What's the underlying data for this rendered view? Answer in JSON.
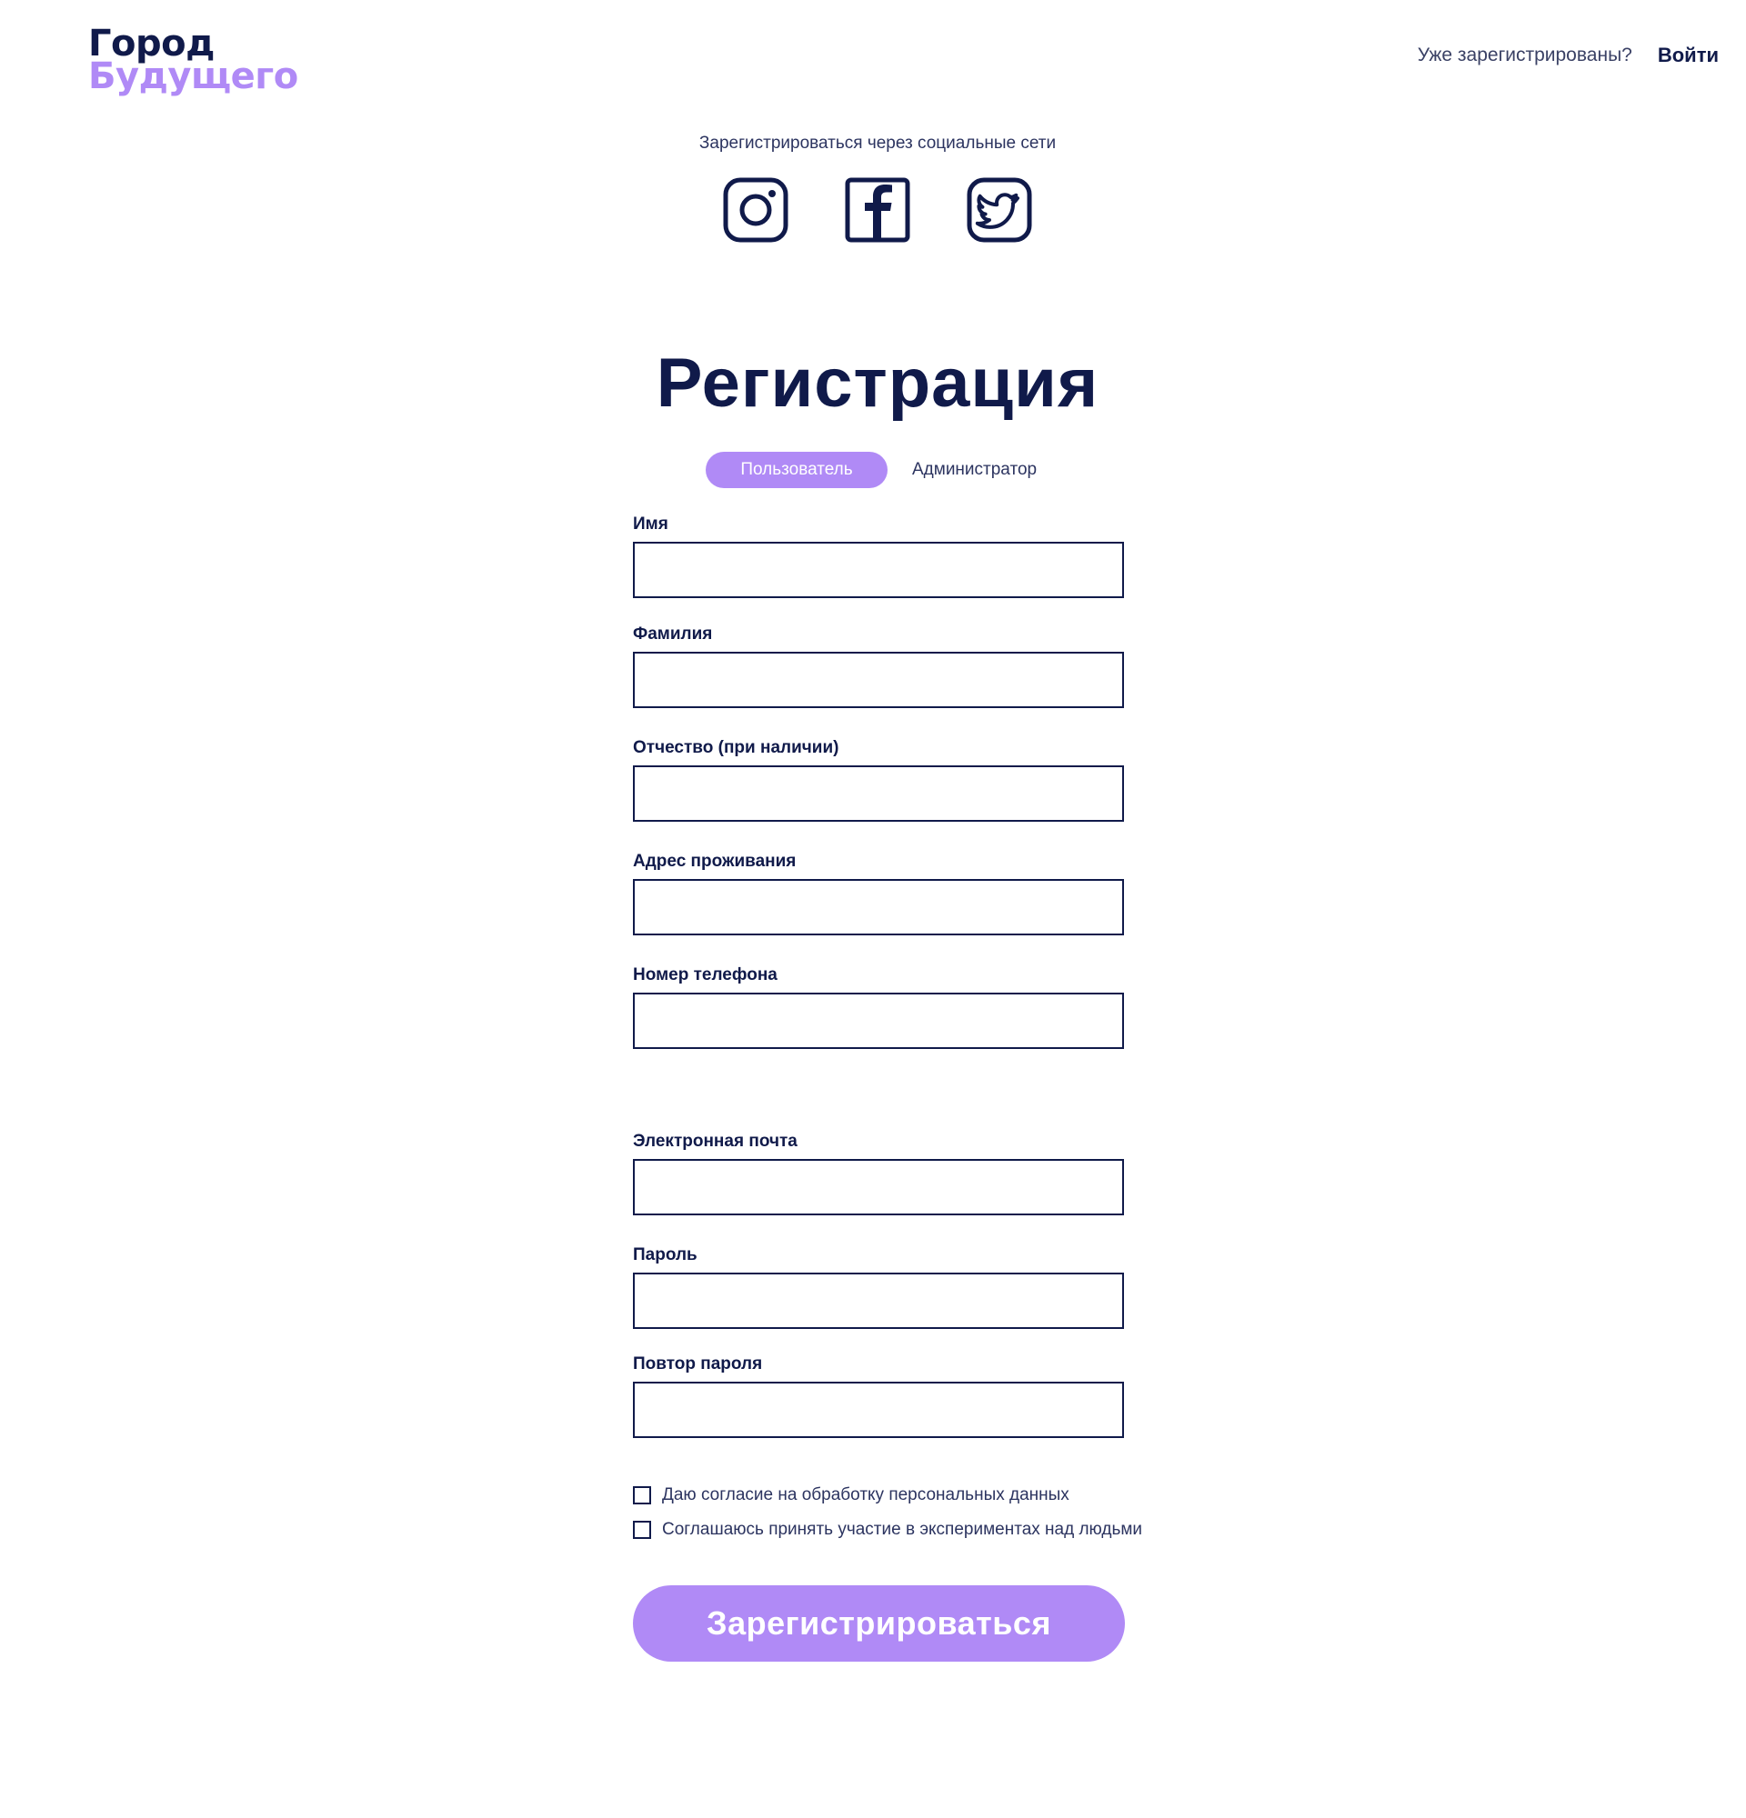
{
  "logo": {
    "line1": "Город",
    "line2": "Будущего"
  },
  "nav": {
    "question": "Уже зарегистрированы?",
    "login": "Войти"
  },
  "social": {
    "caption": "Зарегистрироваться через социальные сети",
    "icons": [
      "instagram-icon",
      "facebook-icon",
      "twitter-icon"
    ]
  },
  "title": "Регистрация",
  "tabs": {
    "user": "Пользователь",
    "admin": "Администратор",
    "active": "user"
  },
  "fields": {
    "first_name": {
      "label": "Имя",
      "value": ""
    },
    "last_name": {
      "label": "Фамилия",
      "value": ""
    },
    "patronymic": {
      "label": "Отчество (при наличии)",
      "value": ""
    },
    "address": {
      "label": "Адрес проживания",
      "value": ""
    },
    "phone": {
      "label": "Номер телефона",
      "value": ""
    },
    "email": {
      "label": "Электронная почта",
      "value": ""
    },
    "password": {
      "label": "Пароль",
      "value": ""
    },
    "password_repeat": {
      "label": "Повтор пароля",
      "value": ""
    }
  },
  "checkboxes": {
    "consent": {
      "label": "Даю согласие на обработку персональных данных",
      "checked": false
    },
    "experiments": {
      "label": "Соглашаюсь принять участие в экспериментах над людьми",
      "checked": false
    }
  },
  "submit": "Зарегистрироваться",
  "colors": {
    "navy": "#101a4a",
    "accent": "#b08af6",
    "text": "#2c3460",
    "background": "#ffffff"
  }
}
